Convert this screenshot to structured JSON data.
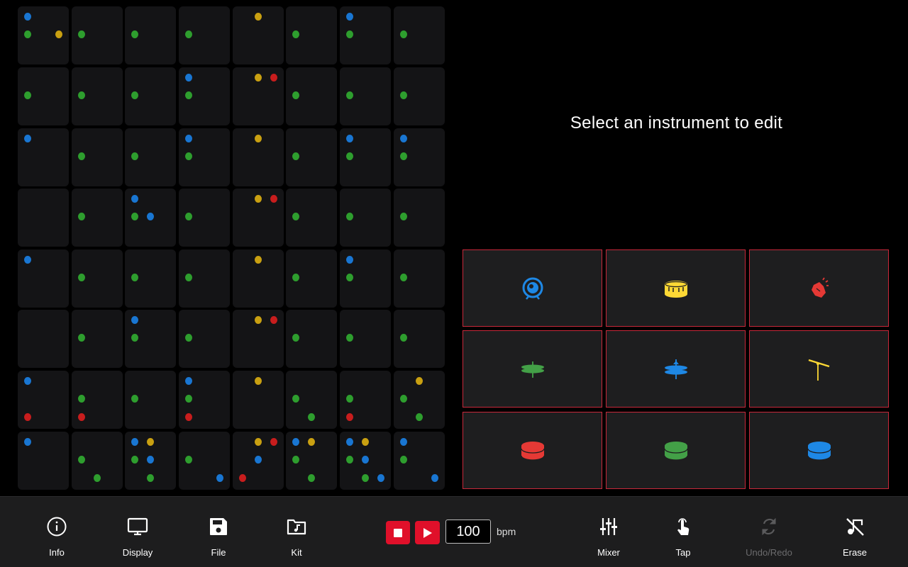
{
  "grid": {
    "rows": 8,
    "cols": 8,
    "colors": {
      "blue": "#1976d2",
      "green": "#2e9e2e",
      "yellow": "#c9a011",
      "red": "#c81d1d"
    },
    "cells": [
      [
        [
          [
            "blue"
          ],
          [
            "green",
            "",
            "yellow"
          ],
          []
        ],
        [
          [],
          [
            "green"
          ],
          []
        ],
        [
          [],
          [
            "green"
          ],
          []
        ],
        [
          [],
          [
            "green"
          ],
          []
        ],
        [
          [
            "",
            "yellow"
          ],
          [],
          []
        ],
        [
          [],
          [
            "green"
          ],
          []
        ],
        [
          [
            "blue"
          ],
          [
            "green"
          ],
          []
        ],
        [
          [],
          [
            "green"
          ],
          []
        ]
      ],
      [
        [
          [],
          [
            "green"
          ],
          []
        ],
        [
          [],
          [
            "green"
          ],
          []
        ],
        [
          [],
          [
            "green"
          ],
          []
        ],
        [
          [
            "blue"
          ],
          [
            "green"
          ],
          []
        ],
        [
          [
            "",
            "yellow",
            "red"
          ],
          [],
          []
        ],
        [
          [],
          [
            "green"
          ],
          []
        ],
        [
          [],
          [
            "green"
          ],
          []
        ],
        [
          [],
          [
            "green"
          ],
          []
        ]
      ],
      [
        [
          [
            "blue"
          ],
          [],
          []
        ],
        [
          [],
          [
            "green"
          ],
          []
        ],
        [
          [],
          [
            "green"
          ],
          []
        ],
        [
          [
            "blue"
          ],
          [
            "green"
          ],
          []
        ],
        [
          [
            "",
            "yellow"
          ],
          [],
          []
        ],
        [
          [],
          [
            "green"
          ],
          []
        ],
        [
          [
            "blue"
          ],
          [
            "green"
          ],
          []
        ],
        [
          [
            "blue"
          ],
          [
            "green"
          ],
          []
        ]
      ],
      [
        [
          [],
          [],
          []
        ],
        [
          [],
          [
            "green"
          ],
          []
        ],
        [
          [
            "blue"
          ],
          [
            "green",
            "blue"
          ],
          []
        ],
        [
          [],
          [
            "green"
          ],
          []
        ],
        [
          [
            "",
            "yellow",
            "red"
          ],
          [],
          []
        ],
        [
          [],
          [
            "green"
          ],
          []
        ],
        [
          [],
          [
            "green"
          ],
          []
        ],
        [
          [],
          [
            "green"
          ],
          []
        ]
      ],
      [
        [
          [
            "blue"
          ],
          [],
          []
        ],
        [
          [],
          [
            "green"
          ],
          []
        ],
        [
          [],
          [
            "green"
          ],
          []
        ],
        [
          [],
          [
            "green"
          ],
          []
        ],
        [
          [
            "",
            "yellow"
          ],
          [],
          []
        ],
        [
          [],
          [
            "green"
          ],
          []
        ],
        [
          [
            "blue"
          ],
          [
            "green"
          ],
          []
        ],
        [
          [],
          [
            "green"
          ],
          []
        ]
      ],
      [
        [
          [],
          [],
          []
        ],
        [
          [],
          [
            "green"
          ],
          []
        ],
        [
          [
            "blue"
          ],
          [
            "green"
          ],
          []
        ],
        [
          [],
          [
            "green"
          ],
          []
        ],
        [
          [
            "",
            "yellow",
            "red"
          ],
          [],
          []
        ],
        [
          [],
          [
            "green"
          ],
          []
        ],
        [
          [],
          [
            "green"
          ],
          []
        ],
        [
          [],
          [
            "green"
          ],
          []
        ]
      ],
      [
        [
          [
            "blue"
          ],
          [],
          [
            "red"
          ]
        ],
        [
          [],
          [
            "green"
          ],
          [
            "red"
          ]
        ],
        [
          [],
          [
            "green"
          ],
          []
        ],
        [
          [
            "blue"
          ],
          [
            "green"
          ],
          [
            "red"
          ]
        ],
        [
          [
            "",
            "yellow"
          ],
          [],
          []
        ],
        [
          [],
          [
            "green"
          ],
          [
            "",
            "green"
          ]
        ],
        [
          [],
          [
            "green"
          ],
          [
            "red"
          ]
        ],
        [
          [
            "",
            "yellow"
          ],
          [
            "green"
          ],
          [
            "",
            "green"
          ]
        ]
      ],
      [
        [
          [
            "blue"
          ],
          [],
          []
        ],
        [
          [],
          [
            "green"
          ],
          [
            "",
            "green"
          ]
        ],
        [
          [
            "blue",
            "yellow"
          ],
          [
            "green",
            "blue"
          ],
          [
            "",
            "green"
          ]
        ],
        [
          [],
          [
            "green"
          ],
          [
            "",
            "",
            "blue"
          ]
        ],
        [
          [
            "",
            "yellow",
            "red"
          ],
          [
            "",
            "blue"
          ],
          [
            "red"
          ]
        ],
        [
          [
            "blue",
            "yellow"
          ],
          [
            "green"
          ],
          [
            "",
            "green"
          ]
        ],
        [
          [
            "blue",
            "yellow"
          ],
          [
            "green",
            "blue"
          ],
          [
            "",
            "green",
            "blue"
          ]
        ],
        [
          [
            "blue"
          ],
          [
            "green"
          ],
          [
            "",
            "",
            "blue"
          ]
        ]
      ]
    ]
  },
  "prompt": "Select an instrument to edit",
  "instruments": [
    {
      "name": "kick-drum",
      "icon": "kick-drum-icon",
      "color": "#1e88e5"
    },
    {
      "name": "snare-drum",
      "icon": "snare-drum-icon",
      "color": "#fdd835"
    },
    {
      "name": "clap",
      "icon": "clap-icon",
      "color": "#e53935"
    },
    {
      "name": "hi-hat",
      "icon": "hi-hat-icon",
      "color": "#43a047"
    },
    {
      "name": "open-hi-hat",
      "icon": "open-hi-hat-icon",
      "color": "#1e88e5"
    },
    {
      "name": "cymbal",
      "icon": "cymbal-icon",
      "color": "#fdd835"
    },
    {
      "name": "tom-red",
      "icon": "tom-icon",
      "color": "#e53935"
    },
    {
      "name": "tom-green",
      "icon": "tom-icon",
      "color": "#43a047"
    },
    {
      "name": "tom-blue",
      "icon": "tom-icon",
      "color": "#1e88e5"
    }
  ],
  "toolbar": {
    "info": "Info",
    "display": "Display",
    "file": "File",
    "kit": "Kit",
    "mixer": "Mixer",
    "tap": "Tap",
    "undo_redo": "Undo/Redo",
    "erase": "Erase"
  },
  "transport": {
    "bpm_value": "100",
    "bpm_label": "bpm",
    "accent": "#e0102a"
  }
}
